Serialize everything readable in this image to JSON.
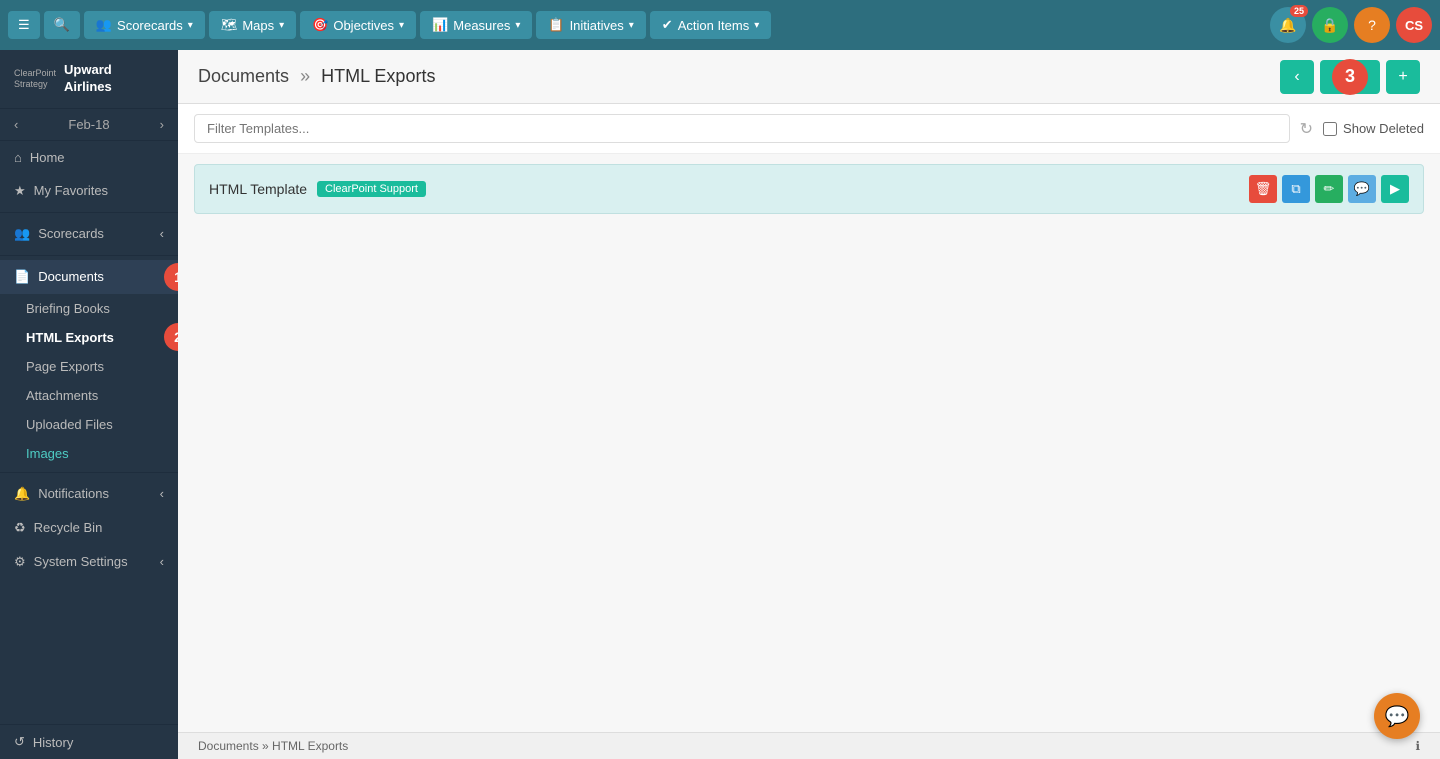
{
  "nav": {
    "menu_icon": "≡",
    "search_icon": "🔍",
    "items": [
      {
        "id": "scorecards",
        "label": "Scorecards",
        "icon": "👥"
      },
      {
        "id": "maps",
        "label": "Maps",
        "icon": "🗺"
      },
      {
        "id": "objectives",
        "label": "Objectives",
        "icon": "🎯"
      },
      {
        "id": "measures",
        "label": "Measures",
        "icon": "📊"
      },
      {
        "id": "initiatives",
        "label": "Initiatives",
        "icon": "📋"
      },
      {
        "id": "action-items",
        "label": "Action Items",
        "icon": "✔"
      }
    ],
    "right": {
      "notifications_count": "25",
      "user_initials": "CS"
    }
  },
  "sidebar": {
    "logo": {
      "clearpoint": "ClearPoint",
      "strategy": "Strategy",
      "company_line1": "Upward",
      "company_line2": "Airlines"
    },
    "period": "Feb-18",
    "nav_items": [
      {
        "id": "home",
        "label": "Home",
        "icon": "⌂"
      },
      {
        "id": "my-favorites",
        "label": "My Favorites",
        "icon": "★"
      }
    ],
    "scorecards_section": {
      "label": "Scorecards",
      "icon": "👥"
    },
    "documents_section": {
      "label": "Documents",
      "sub_items": [
        {
          "id": "briefing-books",
          "label": "Briefing Books"
        },
        {
          "id": "html-exports",
          "label": "HTML Exports",
          "active": true
        },
        {
          "id": "page-exports",
          "label": "Page Exports"
        },
        {
          "id": "attachments",
          "label": "Attachments"
        },
        {
          "id": "uploaded-files",
          "label": "Uploaded Files"
        },
        {
          "id": "images",
          "label": "Images",
          "teal": true
        }
      ]
    },
    "notifications": {
      "label": "Notifications",
      "icon": "🔔"
    },
    "recycle_bin": {
      "label": "Recycle Bin",
      "icon": "♻"
    },
    "system_settings": {
      "label": "System Settings",
      "icon": "⚙"
    },
    "history": {
      "label": "History",
      "icon": "↺"
    }
  },
  "content": {
    "breadcrumb_parent": "Documents",
    "breadcrumb_separator": "»",
    "breadcrumb_current": "HTML Exports",
    "filter_placeholder": "Filter Templates...",
    "show_deleted_label": "Show Deleted",
    "template": {
      "name": "HTML Template",
      "badge": "ClearPoint Support"
    },
    "add_button_label": "+",
    "annotation_3": "3"
  },
  "status_bar": {
    "breadcrumb": "Documents » HTML Exports"
  },
  "colors": {
    "teal": "#1abc9c",
    "dark_sidebar": "#253545",
    "nav_bg": "#2d6e7e",
    "red": "#e74c3c",
    "orange": "#e67e22",
    "green": "#27ae60"
  }
}
